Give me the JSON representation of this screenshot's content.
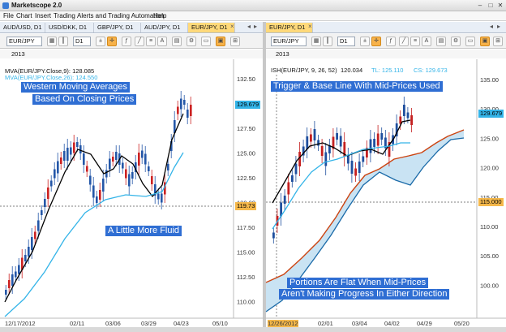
{
  "app": {
    "title": "Marketscope 2.0",
    "minimize": "–",
    "maximize": "□",
    "close": "✕"
  },
  "menu": [
    "File",
    "Chart",
    "Insert",
    "Trading",
    "Alerts and Trading Automation",
    "Help"
  ],
  "tabs_left": [
    "AUD/USD, D1",
    "USD/DKK, D1",
    "GBP/JPY, D1",
    "AUD/JPY, D1",
    "EUR/JPY, D1"
  ],
  "tabs_right": [
    "EUR/JPY, D1"
  ],
  "tab_close": "×",
  "toolbar_left": {
    "instrument": "EUR/JPY",
    "timeframe": "D1"
  },
  "toolbar_right": {
    "instrument": "EUR/JPY",
    "timeframe": "D1"
  },
  "left_chart": {
    "year": "2013",
    "indicator1": "MVA(EUR/JPY.Close,9): 128.085",
    "indicator2": "MVA(EUR/JPY.Close,26): 124.550",
    "banner_top_1": "Western Moving Averages",
    "banner_top_2": "Based On Closing Prices",
    "banner_mid": "A Little More Fluid",
    "y_ticks": [
      "132.50",
      "130.00",
      "127.50",
      "125.00",
      "122.50",
      "120.00",
      "117.50",
      "115.00",
      "112.50",
      "110.00"
    ],
    "price_current": "129.679",
    "price_mark": "119.73",
    "x_labels": [
      "12/17/2012",
      "02/11",
      "03/06",
      "03/29",
      "04/23",
      "05/10"
    ],
    "colors": {
      "candle_up": "#2457a8",
      "candle_down": "#cc2222",
      "ma_fast": "#000000",
      "ma_slow": "#34b4e8"
    }
  },
  "right_chart": {
    "year": "2013",
    "indicator1": "ISH(EUR/JPY, 9, 26, 52)",
    "ind_value": "120.034",
    "tl_label": "TL: 125.110",
    "cs_label": "CS: 129.673",
    "banner_top": "Trigger & Base Line With Mid-Prices Used",
    "banner_bottom_1": "Portions Are Flat When Mid-Prices",
    "banner_bottom_2": "Aren't Making Progress In Either Direction",
    "y_ticks": [
      "135.00",
      "130.00",
      "125.00",
      "120.00",
      "115.00",
      "110.00",
      "105.00",
      "100.00"
    ],
    "price_current": "129.679",
    "price_mark": "115.000",
    "x_labels": [
      "12/26/2012",
      "02/01",
      "03/04",
      "04/02",
      "04/29",
      "05/20"
    ],
    "colors": {
      "tenkan": "#000000",
      "kijun": "#34b4e8",
      "senkou_a": "#1a6aa8",
      "senkou_b": "#cc4411",
      "cloud": "#c9e3f3"
    }
  }
}
